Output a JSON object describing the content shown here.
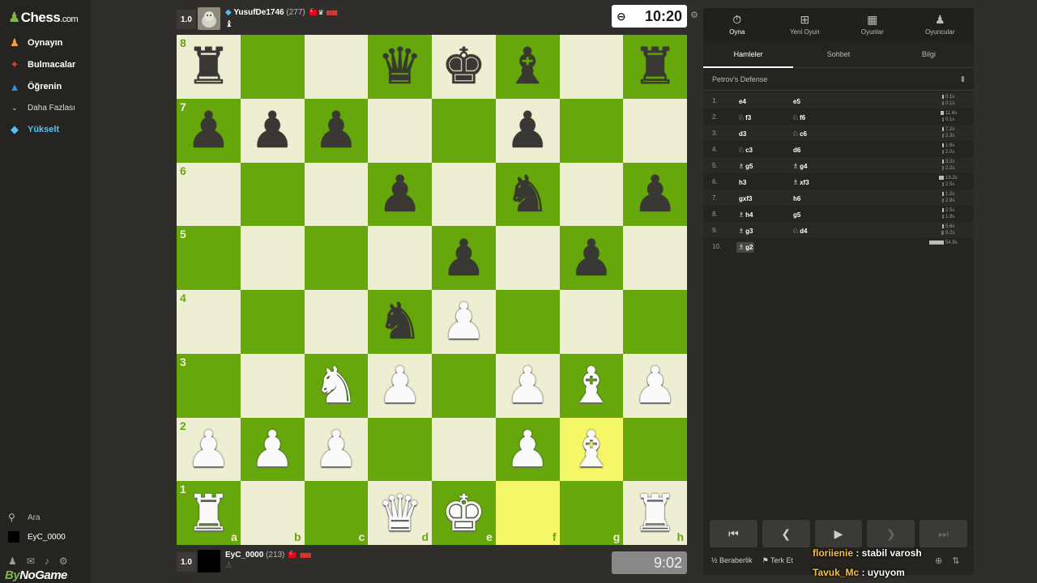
{
  "brand": {
    "logo": "Chess",
    "logo_suffix": ".com",
    "watermark_a": "By",
    "watermark_b": "No",
    "watermark_c": "Game"
  },
  "sidebar": {
    "items": [
      {
        "label": "Oynayın",
        "icon": "pawn-play-icon"
      },
      {
        "label": "Bulmacalar",
        "icon": "puzzle-icon"
      },
      {
        "label": "Öğrenin",
        "icon": "graduation-cap-icon"
      },
      {
        "label": "Daha Fazlası",
        "icon": "chevron-down-icon"
      },
      {
        "label": "Yükselt",
        "icon": "diamond-icon"
      }
    ],
    "search": "Ara",
    "user": "EyC_0000"
  },
  "top_player": {
    "score": "1.0",
    "name": "YusufDe1746",
    "rating": "(277)"
  },
  "bottom_player": {
    "score": "1.0",
    "name": "EyC_0000",
    "rating": "(213)"
  },
  "clocks": {
    "top": "10:20",
    "bottom": "9:02"
  },
  "board": {
    "highlight_squares": [
      "g2",
      "f1"
    ],
    "position": {
      "a8": "r",
      "d8": "q",
      "e8": "k",
      "f8": "b",
      "h8": "r",
      "a7": "p",
      "b7": "p",
      "c7": "p",
      "f7": "p",
      "d6": "p",
      "f6": "n",
      "h6": "p",
      "e5": "p",
      "g5": "p",
      "d4": "n",
      "e4": "P",
      "c3": "N",
      "d3": "P",
      "f3": "P",
      "g3": "B",
      "h3": "P",
      "a2": "P",
      "b2": "P",
      "c2": "P",
      "f2": "P",
      "g2": "B",
      "a1": "R",
      "d1": "Q",
      "e1": "K",
      "h1": "R"
    },
    "ranks": [
      "8",
      "7",
      "6",
      "5",
      "4",
      "3",
      "2",
      "1"
    ],
    "files": [
      "a",
      "b",
      "c",
      "d",
      "e",
      "f",
      "g",
      "h"
    ]
  },
  "panel": {
    "top_tabs": [
      "Oyna",
      "Yeni Oyun",
      "Oyunlar",
      "Oyuncular"
    ],
    "sub_tabs": [
      "Hamleler",
      "Sohbet",
      "Bilgi"
    ],
    "opening": "Petrov's Defense",
    "moves": [
      {
        "n": "1.",
        "w": "e4",
        "wp": "",
        "b": "e5",
        "bp": "",
        "wt": "0.1s",
        "bt": "0.1s",
        "wf": 0.01,
        "bf": 0.01
      },
      {
        "n": "2.",
        "w": "f3",
        "wp": "♘",
        "b": "f6",
        "bp": "♘",
        "wt": "11.6s",
        "bt": "0.1s",
        "wf": 0.21,
        "bf": 0.01
      },
      {
        "n": "3.",
        "w": "d3",
        "wp": "",
        "b": "c6",
        "bp": "♘",
        "wt": "7.2s",
        "bt": "2.3s",
        "wf": 0.13,
        "bf": 0.04
      },
      {
        "n": "4.",
        "w": "c3",
        "wp": "♘",
        "b": "d6",
        "bp": "",
        "wt": "1.8s",
        "bt": "2.0s",
        "wf": 0.03,
        "bf": 0.04
      },
      {
        "n": "5.",
        "w": "g5",
        "wp": "♗",
        "b": "g4",
        "bp": "♗",
        "wt": "3.2s",
        "bt": "2.2s",
        "wf": 0.06,
        "bf": 0.04
      },
      {
        "n": "6.",
        "w": "h3",
        "wp": "",
        "b": "xf3",
        "bp": "♗",
        "wt": "19.2s",
        "bt": "2.5s",
        "wf": 0.35,
        "bf": 0.05
      },
      {
        "n": "7.",
        "w": "gxf3",
        "wp": "",
        "b": "h6",
        "bp": "",
        "wt": "1.2s",
        "bt": "2.9s",
        "wf": 0.02,
        "bf": 0.05
      },
      {
        "n": "8.",
        "w": "h4",
        "wp": "♗",
        "b": "g5",
        "bp": "",
        "wt": "2.5s",
        "bt": "1.9s",
        "wf": 0.05,
        "bf": 0.03
      },
      {
        "n": "9.",
        "w": "g3",
        "wp": "♗",
        "b": "d4",
        "bp": "♘",
        "wt": "5.6s",
        "bt": "9.2s",
        "wf": 0.1,
        "bf": 0.17
      },
      {
        "n": "10.",
        "w": "g2",
        "wp": "♗",
        "b": "",
        "bp": "",
        "wt": "54.8s",
        "bt": "",
        "wf": 1.0,
        "bf": 0
      }
    ],
    "current_move": "10. g2",
    "draw": "Beraberlik",
    "draw_icon": "½",
    "resign": "Terk Et"
  },
  "chat": [
    {
      "user": "floriienie",
      "text": " : stabil varosh"
    },
    {
      "user": "Tavuk_Mc",
      "text": " : uyuyom"
    }
  ]
}
